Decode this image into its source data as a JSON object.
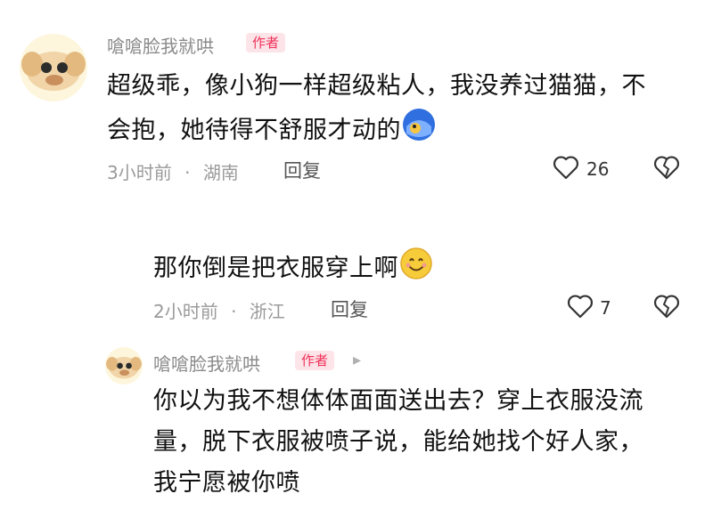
{
  "comments": [
    {
      "username": "嗆嗆脸我就哄",
      "badge": "作者",
      "text_line1": "超级乖，像小狗一样超级粘人，我没养过猫猫，不",
      "text_line2": "会抱，她待得不舒服才动的",
      "time": "3小时前",
      "location": "湖南",
      "reply_label": "回复",
      "likes": "26",
      "emoji_name": "shy-blue-emoji"
    },
    {
      "text": "那你倒是把衣服穿上啊",
      "time": "2小时前",
      "location": "浙江",
      "reply_label": "回复",
      "likes": "7",
      "emoji_name": "smile-emoji"
    },
    {
      "username": "嗆嗆脸我就哄",
      "badge": "作者",
      "reply_arrow": "▸",
      "text_line1": "你以为我不想体体面面送出去？穿上衣服没流",
      "text_line2": "量，脱下衣服被喷子说，能给她找个好人家，",
      "text_line3": "我宁愿被你喷"
    }
  ],
  "separator": "·"
}
